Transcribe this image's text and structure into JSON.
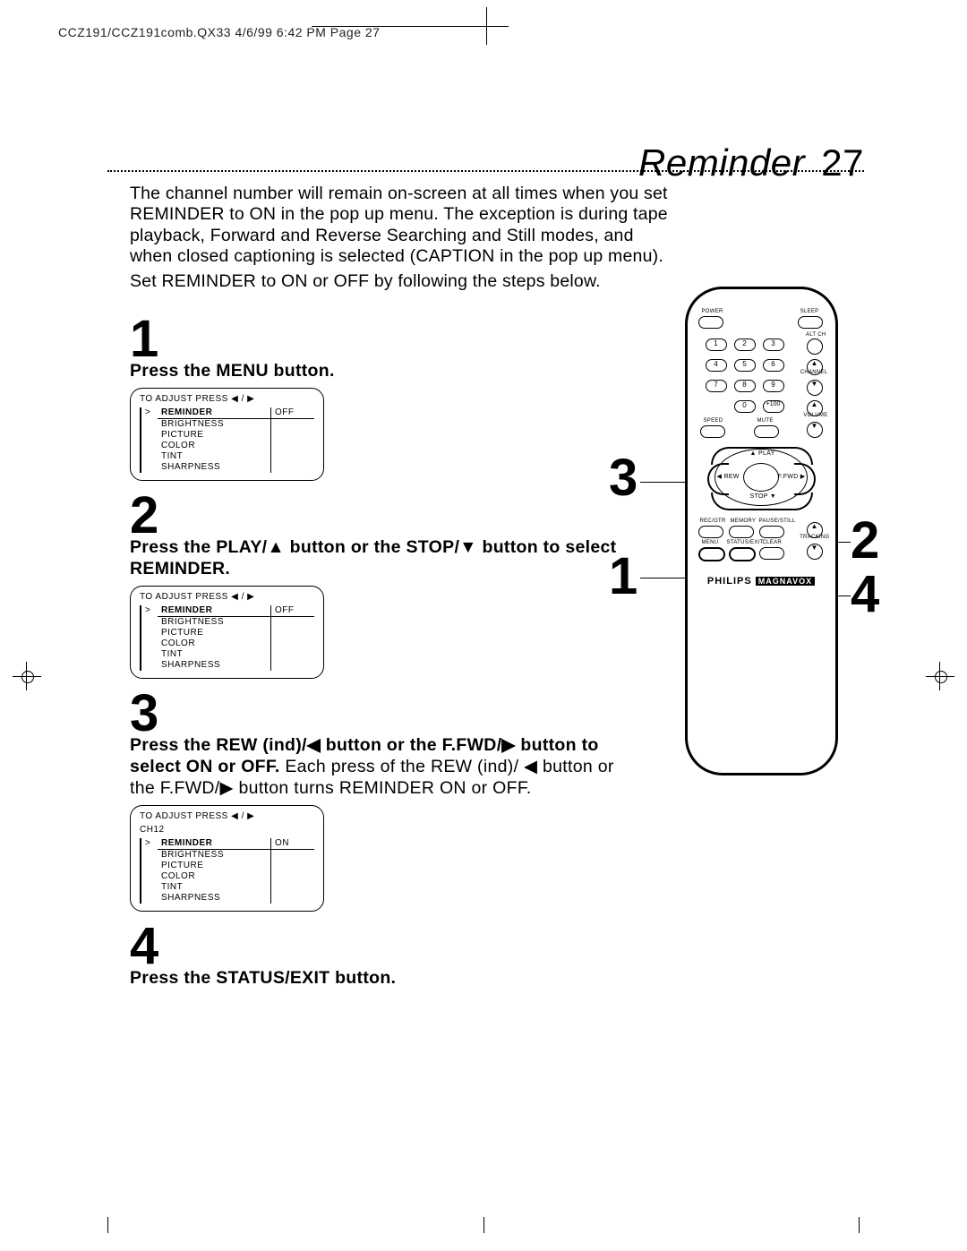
{
  "header": "CCZ191/CCZ191comb.QX33  4/6/99 6:42 PM  Page 27",
  "title_word": "Reminder",
  "title_num": "27",
  "intro_p1": "The channel number will remain on-screen at all times when you set REMINDER to ON in the pop up menu. The exception is during tape playback, Forward and Reverse Searching and Still modes, and when closed captioning is selected (CAPTION in the pop up menu).",
  "intro_p2": "Set REMINDER to ON or OFF by following the steps below.",
  "steps": {
    "s1": {
      "num": "1",
      "line": "Press the MENU button."
    },
    "s2": {
      "num": "2",
      "line1": "Press the PLAY/▲ button or the STOP/▼ button to select",
      "line2": "REMINDER."
    },
    "s3": {
      "num": "3",
      "line1a": "Press the REW (ind)/◀ button or the F.FWD/▶ button to",
      "line1b": "select ON or OFF.",
      "line2": " Each press of the REW (ind)/ ◀ button or the F.FWD/▶ button turns REMINDER ON or OFF."
    },
    "s4": {
      "num": "4",
      "line": "Press the STATUS/EXIT button."
    }
  },
  "osd": {
    "head": "TO ADJUST PRESS  ◀ / ▶",
    "ch": "CH12",
    "items": [
      "REMINDER",
      "BRIGHTNESS",
      "PICTURE",
      "COLOR",
      "TINT",
      "SHARPNESS"
    ],
    "off": "OFF",
    "on": "ON"
  },
  "remote": {
    "power": "POWER",
    "sleep": "SLEEP",
    "altch": "ALT CH",
    "channel": "CHANNEL",
    "speed": "SPEED",
    "mute": "MUTE",
    "volume": "VOLUME",
    "play": "PLAY",
    "rew": "REW",
    "ffwd": "F.FWD",
    "stop": "STOP",
    "recotr": "REC/OTR",
    "memory": "MEMORY",
    "pausestill": "PAUSE/STILL",
    "menu": "MENU",
    "statusexit": "STATUS/EXIT",
    "clear": "CLEAR",
    "tracking": "TRACKING",
    "brand1": "PHILIPS",
    "brand2": "MAGNAVOX",
    "plus100": "+100"
  },
  "callouts": {
    "c1": "1",
    "c2": "2",
    "c3": "3",
    "c4": "4"
  }
}
